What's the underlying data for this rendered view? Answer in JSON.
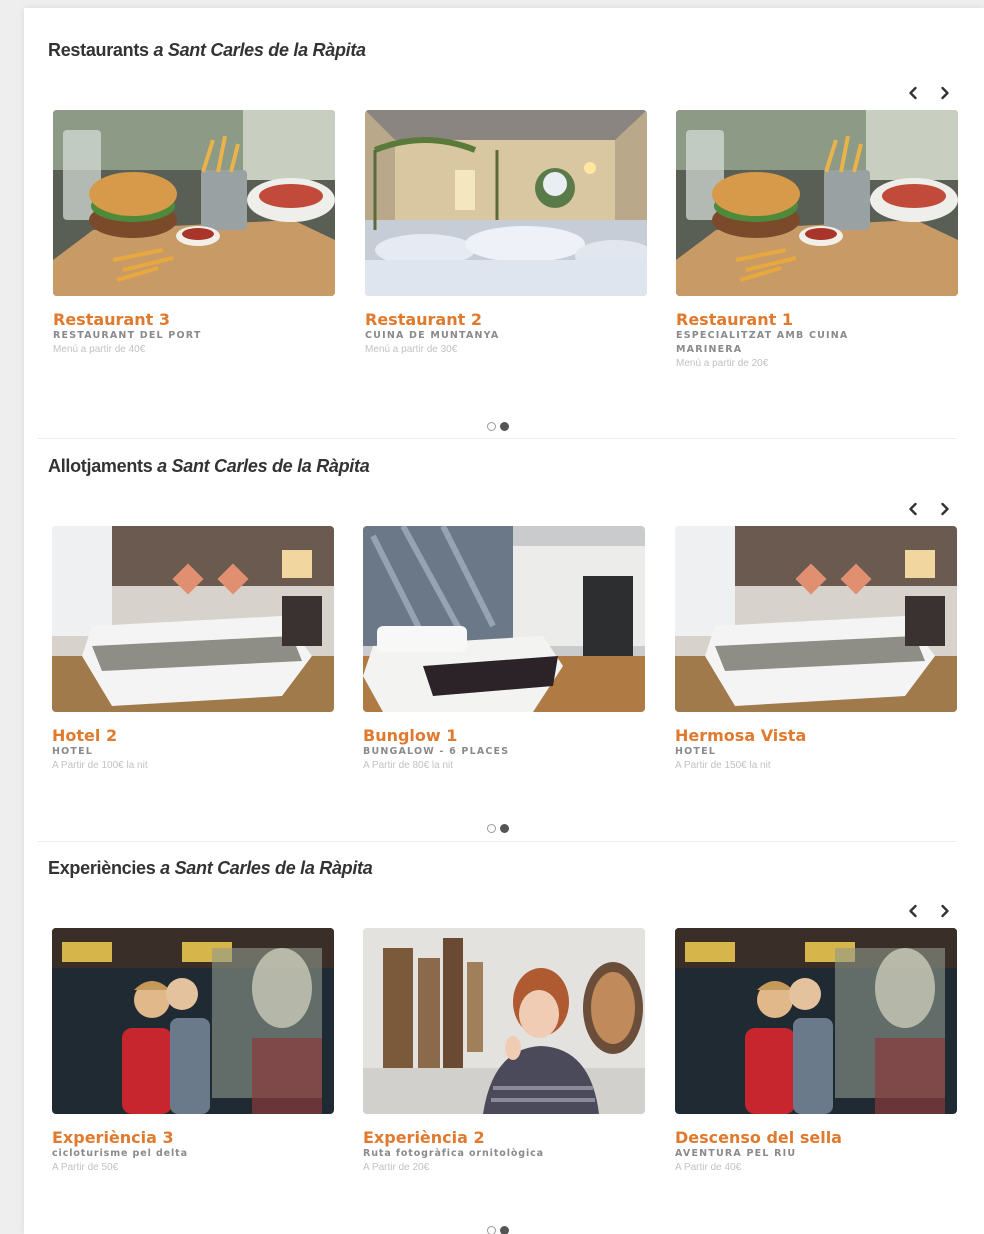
{
  "sections": [
    {
      "title": "Restaurants",
      "location": "a Sant Carles de la Ràpita",
      "cards": [
        {
          "name": "Restaurant 3",
          "type": "RESTAURANT DEL PORT",
          "price": "Menú a partir de 40€",
          "image": "burger-plate"
        },
        {
          "name": "Restaurant 2",
          "type": "CUINA DE MUNTANYA",
          "price": "Menú a partir de 30€",
          "image": "banquet-hall"
        },
        {
          "name": "Restaurant 1",
          "type": "ESPECIALITZAT AMB CUINA MARINERA",
          "price": "Menú a partir de 20€",
          "image": "burger-plate"
        }
      ]
    },
    {
      "title": "Allotjaments",
      "location": "a Sant Carles de la Ràpita",
      "cards": [
        {
          "name": "Hotel 2",
          "type": "HOTEL",
          "price": "A Partir de 100€ la nit",
          "image": "hotel-room"
        },
        {
          "name": "Bunglow 1",
          "type": "BUNGALOW - 6 PLACES",
          "price": "A Partir de 80€ la nit",
          "image": "bungalow-room"
        },
        {
          "name": "Hermosa Vista",
          "type": "HOTEL",
          "price": "A Partir de 150€ la nit",
          "image": "hotel-room"
        }
      ]
    },
    {
      "title": "Experiències",
      "location": "a Sant Carles de la Ràpita",
      "cards": [
        {
          "name": "Experiència 3",
          "type": "cicloturisme pel delta",
          "price": "A Partir de 50€",
          "image": "museum-kids"
        },
        {
          "name": "Experiència 2",
          "type": "Ruta fotogràfica ornitològica",
          "price": "A Partir de 20€",
          "image": "gallery-woman"
        },
        {
          "name": "Descenso del sella",
          "type": "AVENTURA PEL RIU",
          "price": "A Partir de 40€",
          "image": "museum-kids"
        }
      ]
    }
  ],
  "carousel": {
    "pages": 2,
    "active_page": 2
  },
  "colors": {
    "accent": "#e07a2e",
    "type_text": "#8a8a8a",
    "price_text": "#c2c2c2"
  },
  "icons": {
    "prev": "chevron-left-icon",
    "next": "chevron-right-icon"
  }
}
